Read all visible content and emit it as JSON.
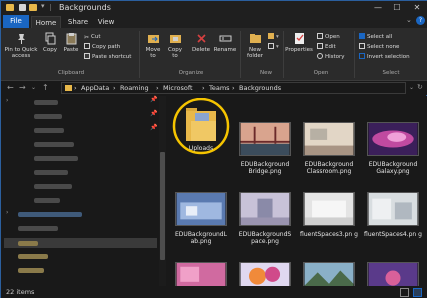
{
  "window": {
    "title": "Backgrounds",
    "controls": [
      "—",
      "☐",
      "✕"
    ],
    "accent": "#1a66c2"
  },
  "ribbon_tabs": [
    "File",
    "Home",
    "Share",
    "View"
  ],
  "ribbon": {
    "clipboard": {
      "pin_label": "Pin to Quick access",
      "copy_label": "Copy",
      "paste_label": "Paste",
      "cut_label": "Cut",
      "copy_path_label": "Copy path",
      "paste_shortcut_label": "Paste shortcut",
      "group_label": "Clipboard"
    },
    "organize": {
      "move_to_label": "Move to",
      "copy_to_label": "Copy to",
      "delete_label": "Delete",
      "rename_label": "Rename",
      "group_label": "Organize"
    },
    "new": {
      "new_folder_label": "New folder",
      "group_label": "New"
    },
    "open": {
      "properties_label": "Properties",
      "open_label": "Open",
      "edit_label": "Edit",
      "history_label": "History",
      "group_label": "Open"
    },
    "select": {
      "select_all_label": "Select all",
      "select_none_label": "Select none",
      "invert_label": "Invert selection",
      "group_label": "Select"
    }
  },
  "breadcrumb": [
    "AppData",
    "Roaming",
    "Microsoft",
    "Teams",
    "Backgrounds"
  ],
  "files": [
    {
      "name": "Uploads",
      "kind": "folder"
    },
    {
      "name": "EDUBackground Bridge.png",
      "kind": "image"
    },
    {
      "name": "EDUBackground Classroom.png",
      "kind": "image"
    },
    {
      "name": "EDUBackground Galaxy.png",
      "kind": "image"
    },
    {
      "name": "EDUBackgroundL ab.png",
      "kind": "image"
    },
    {
      "name": "EDUBackgroundS pace.png",
      "kind": "image"
    },
    {
      "name": "fluentSpaces3.pn g",
      "kind": "image"
    },
    {
      "name": "fluentSpaces4.pn g",
      "kind": "image"
    },
    {
      "name": "",
      "kind": "image"
    },
    {
      "name": "",
      "kind": "image"
    },
    {
      "name": "",
      "kind": "image"
    },
    {
      "name": "",
      "kind": "image"
    }
  ],
  "highlight_color": "#f5c400",
  "status": {
    "items_count": "22 items"
  }
}
